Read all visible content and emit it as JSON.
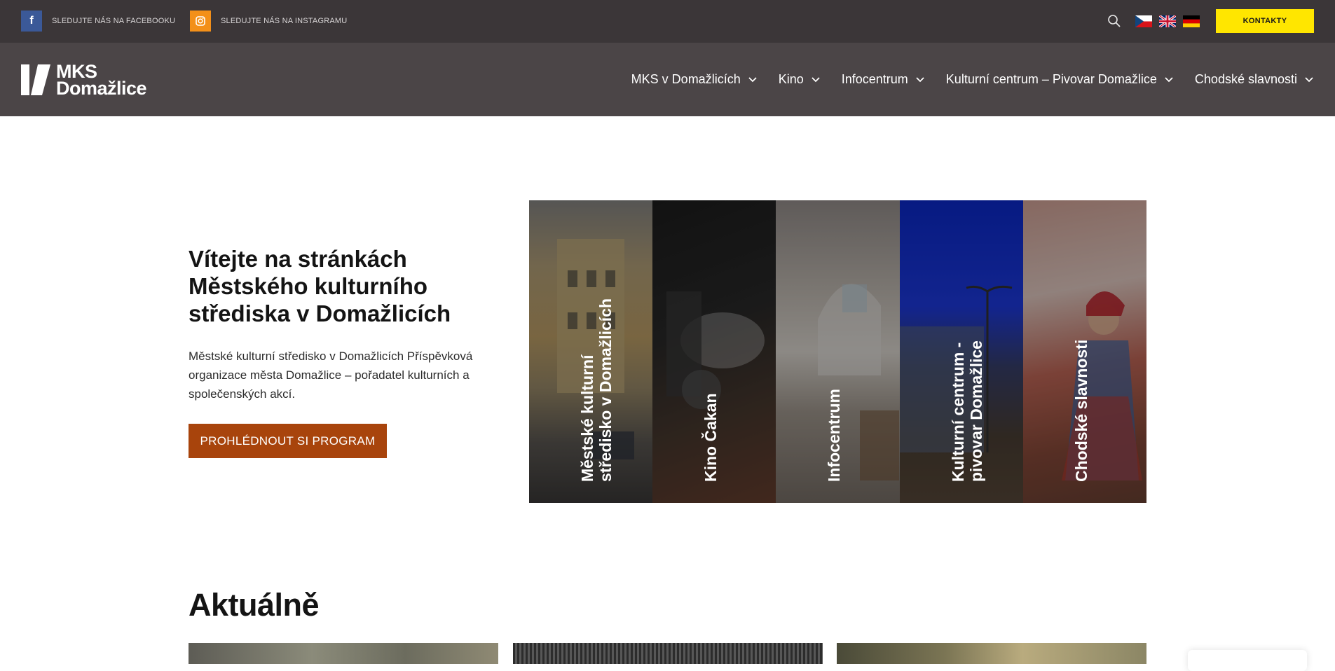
{
  "topbar": {
    "facebook": {
      "icon": "facebook-icon",
      "label": "SLEDUJTE NÁS NA FACEBOOKU"
    },
    "instagram": {
      "icon": "instagram-icon",
      "label": "SLEDUJTE NÁS NA INSTAGRAMU"
    },
    "languages": [
      "cs-flag-icon",
      "en-flag-icon",
      "de-flag-icon"
    ],
    "contact_label": "KONTAKTY"
  },
  "nav": {
    "logo": {
      "line1": "MKS",
      "line2": "Domažlice"
    },
    "items": [
      {
        "label": "MKS v Domažlicích"
      },
      {
        "label": "Kino"
      },
      {
        "label": "Infocentrum"
      },
      {
        "label": "Kulturní centrum – Pivovar Domažlice"
      },
      {
        "label": "Chodské slavnosti"
      }
    ]
  },
  "hero": {
    "title": "Vítejte na stránkách Městského kulturního střediska v Domažlicích",
    "text": "Městské kulturní středisko v Domažlicích Příspěvková organizace města Domažlice – pořadatel kulturních a společenských akcí.",
    "button_label": "PROHLÉDNOUT SI PROGRAM"
  },
  "panels": [
    {
      "label": "Městské kulturní středisko v Domažlicích"
    },
    {
      "label": "Kino Čakan"
    },
    {
      "label": "Infocentrum"
    },
    {
      "label": "Kulturní centrum - pivovar Domažlice"
    },
    {
      "label": "Chodské slavnosti"
    }
  ],
  "news": {
    "title": "Aktuálně"
  },
  "colors": {
    "topbar": "#3b3638",
    "navbar": "#4b4547",
    "accent_yellow": "#ffe600",
    "button": "#a8440c"
  }
}
